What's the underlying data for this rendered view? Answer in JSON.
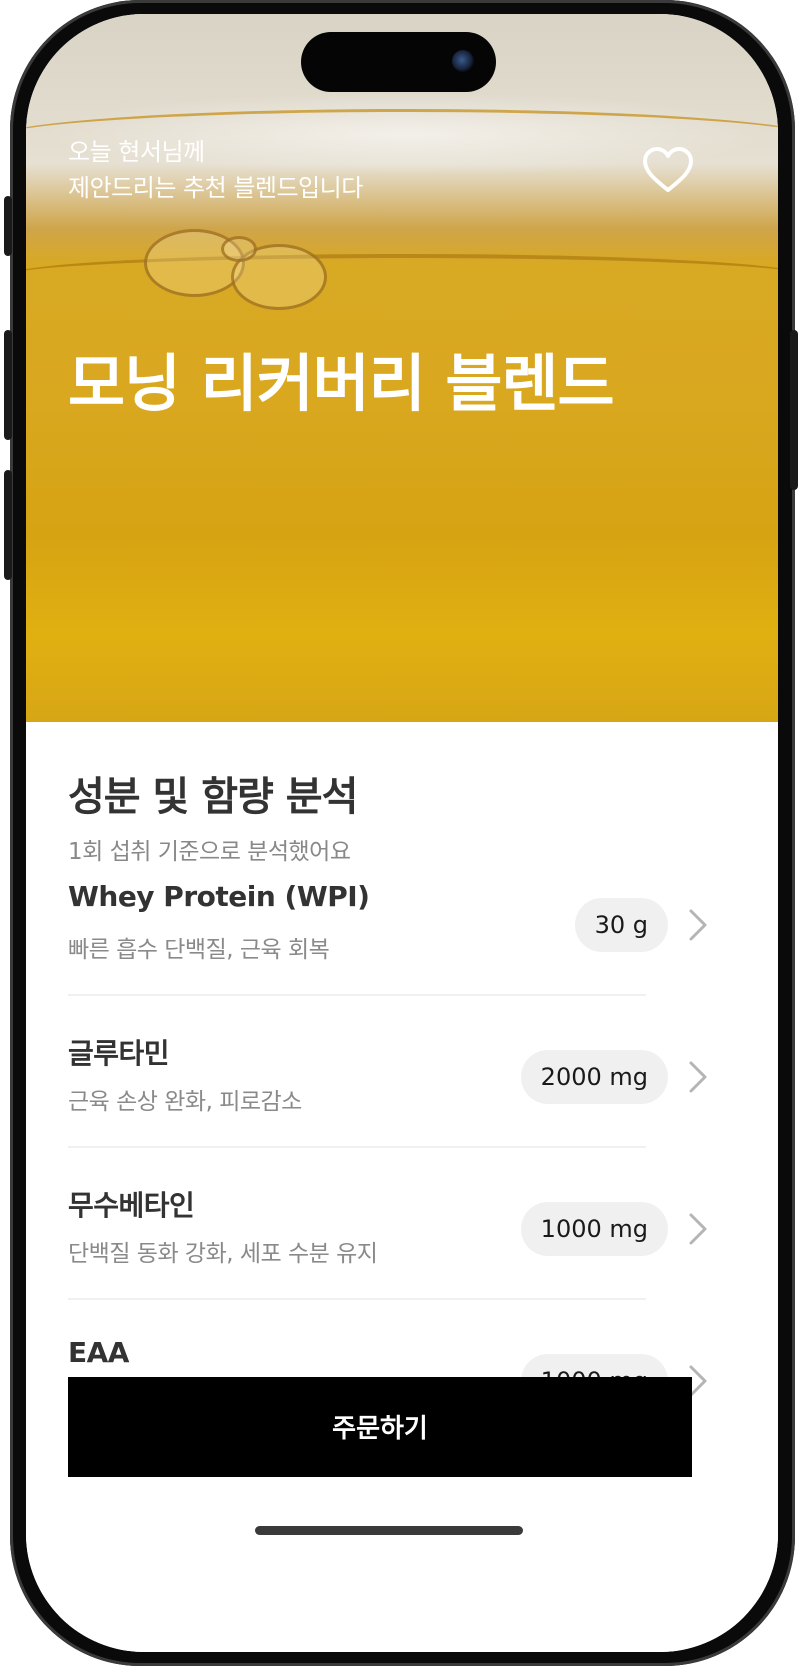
{
  "hero": {
    "subtitle": "오늘 현서님께\n제안드리는 추천 블렌드입니다",
    "title": "모닝 리커버리 블렌드",
    "favorite_icon": "heart-outline-icon"
  },
  "analysis": {
    "title": "성분 및 함량 분석",
    "subtitle": "1회 섭취 기준으로 분석했어요",
    "ingredients": [
      {
        "name": "Whey Protein (WPI)",
        "description": "빠른 흡수 단백질, 근육 회복",
        "amount": "30 g"
      },
      {
        "name": "글루타민",
        "description": "근육 손상 완화, 피로감소",
        "amount": "2000 mg"
      },
      {
        "name": "무수베타인",
        "description": "단백질 동화 강화, 세포 수분 유지",
        "amount": "1000 mg"
      },
      {
        "name": "EAA",
        "description": "",
        "amount": "1000 mg"
      }
    ]
  },
  "footer": {
    "order_label": "주문하기"
  },
  "colors": {
    "accent": "#000000",
    "hero_amber": "#d9a81f",
    "pill_bg": "#f0f0f0"
  }
}
